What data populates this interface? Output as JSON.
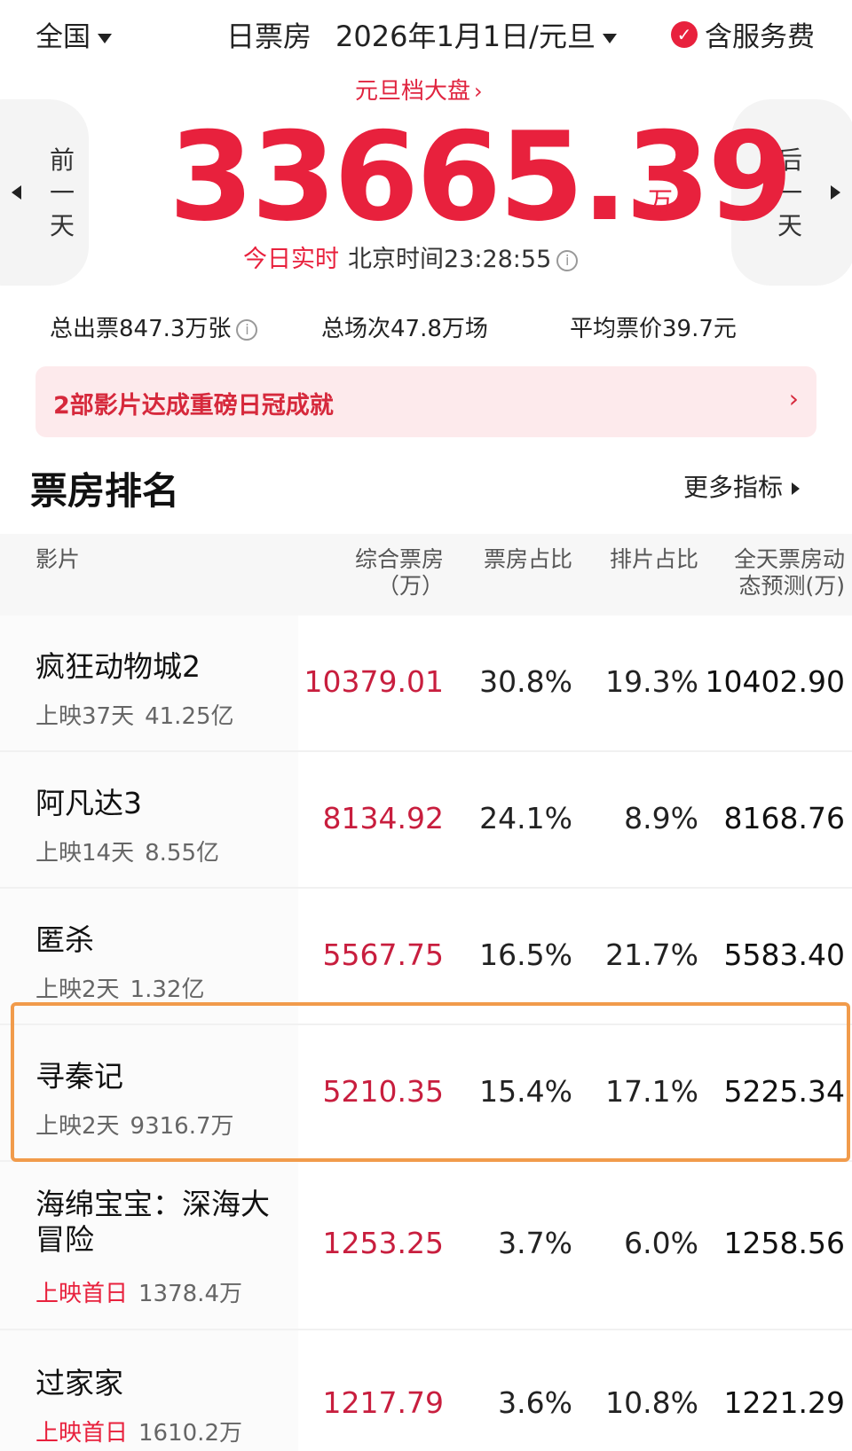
{
  "header": {
    "region": "全国",
    "title": "日票房",
    "date": "2026年1月1日/元旦",
    "service_fee_label": "含服务费",
    "service_fee_checked": true
  },
  "hero": {
    "holiday_link": "元旦档大盘",
    "prev_day": [
      "前",
      "一",
      "天"
    ],
    "next_day": [
      "后",
      "一",
      "天"
    ],
    "total_box": "33665.39",
    "unit": "万",
    "realtime_label": "今日实时",
    "beijing_time": "北京时间23:28:55"
  },
  "stats": {
    "tickets": "总出票847.3万张",
    "shows": "总场次47.8万场",
    "avg_price": "平均票价39.7元"
  },
  "banner": {
    "text": "2部影片达成重磅日冠成就"
  },
  "ranking": {
    "title": "票房排名",
    "more_label": "更多指标",
    "columns": {
      "film": "影片",
      "box": [
        "综合票房",
        "（万）"
      ],
      "share": "票房占比",
      "schedule": "排片占比",
      "prediction": [
        "全天票房动",
        "态预测(万)"
      ]
    },
    "rows": [
      {
        "name": "疯狂动物城2",
        "days": "上映37天",
        "gross": "41.25亿",
        "box": "10379.01",
        "share": "30.8%",
        "schedule": "19.3%",
        "prediction": "10402.90"
      },
      {
        "name": "阿凡达3",
        "days": "上映14天",
        "gross": "8.55亿",
        "box": "8134.92",
        "share": "24.1%",
        "schedule": "8.9%",
        "prediction": "8168.76"
      },
      {
        "name": "匿杀",
        "days": "上映2天",
        "gross": "1.32亿",
        "box": "5567.75",
        "share": "16.5%",
        "schedule": "21.7%",
        "prediction": "5583.40"
      },
      {
        "name": "寻秦记",
        "days": "上映2天",
        "gross": "9316.7万",
        "box": "5210.35",
        "share": "15.4%",
        "schedule": "17.1%",
        "prediction": "5225.34"
      },
      {
        "name": "海绵宝宝：深海大冒险",
        "days": "上映首日",
        "gross": "1378.4万",
        "box": "1253.25",
        "share": "3.7%",
        "schedule": "6.0%",
        "prediction": "1258.56"
      },
      {
        "name": "过家家",
        "days": "上映首日",
        "gross": "1610.2万",
        "box": "1217.79",
        "share": "3.6%",
        "schedule": "10.8%",
        "prediction": "1221.29"
      }
    ]
  },
  "colors": {
    "accent_red": "#e8213d",
    "banner_bg": "#fdeaec",
    "highlight_orange": "#f19b4b"
  }
}
